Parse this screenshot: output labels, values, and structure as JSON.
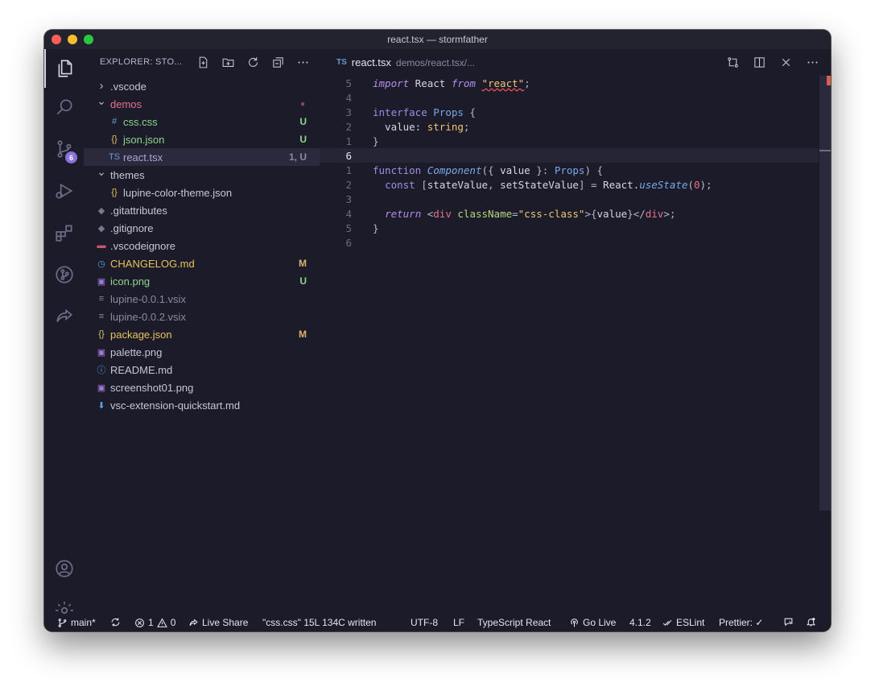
{
  "window": {
    "title": "react.tsx — stormfather"
  },
  "activity": {
    "scm_badge": "6"
  },
  "sidebar": {
    "title": "EXPLORER: STO...",
    "items": [
      {
        "label": ".vscode",
        "type": "folder",
        "expanded": false,
        "indent": 0,
        "color": "#c8c6d6",
        "icon": "chevron-right-icon",
        "status": ""
      },
      {
        "label": "demos",
        "type": "folder",
        "expanded": true,
        "indent": 0,
        "color": "#e8708a",
        "icon": "chevron-down-icon",
        "status": "●",
        "status_color": "#8b4a56"
      },
      {
        "label": "css.css",
        "type": "file",
        "indent": 1,
        "color": "#8fd48a",
        "icon": "hash-icon",
        "icon_glyph": "#",
        "icon_color": "#5aa3d9",
        "status": "U",
        "status_color": "#8fd48a"
      },
      {
        "label": "json.json",
        "type": "file",
        "indent": 1,
        "color": "#8fd48a",
        "icon": "braces-icon",
        "icon_glyph": "{}",
        "icon_color": "#e8c35a",
        "status": "U",
        "status_color": "#8fd48a"
      },
      {
        "label": "react.tsx",
        "type": "file",
        "indent": 1,
        "color": "#a9a4d6",
        "icon": "typescript-icon",
        "icon_glyph": "TS",
        "icon_color": "#6f97d0",
        "status": "1, U",
        "status_color": "#8d8aa0",
        "selected": true
      },
      {
        "label": "themes",
        "type": "folder",
        "expanded": true,
        "indent": 0,
        "color": "#c8c6d6",
        "icon": "chevron-down-icon",
        "status": ""
      },
      {
        "label": "lupine-color-theme.json",
        "type": "file",
        "indent": 1,
        "color": "#c8c6d6",
        "icon": "braces-icon",
        "icon_glyph": "{}",
        "icon_color": "#e8c35a",
        "status": ""
      },
      {
        "label": ".gitattributes",
        "type": "file",
        "indent": 0,
        "color": "#c8c6d6",
        "icon": "git-diamond-icon",
        "icon_glyph": "◆",
        "icon_color": "#7a7890",
        "status": ""
      },
      {
        "label": ".gitignore",
        "type": "file",
        "indent": 0,
        "color": "#c8c6d6",
        "icon": "git-diamond-icon",
        "icon_glyph": "◆",
        "icon_color": "#7a7890",
        "status": ""
      },
      {
        "label": ".vscodeignore",
        "type": "file",
        "indent": 0,
        "color": "#c8c6d6",
        "icon": "ignore-icon",
        "icon_glyph": "▬",
        "icon_color": "#c75a6a",
        "status": ""
      },
      {
        "label": "CHANGELOG.md",
        "type": "file",
        "indent": 0,
        "color": "#e8c35a",
        "icon": "clock-icon",
        "icon_glyph": "◷",
        "icon_color": "#5aa3d9",
        "status": "M",
        "status_color": "#d9b46a"
      },
      {
        "label": "icon.png",
        "type": "file",
        "indent": 0,
        "color": "#8fd48a",
        "icon": "image-icon",
        "icon_glyph": "▣",
        "icon_color": "#a07ad8",
        "status": "U",
        "status_color": "#8fd48a"
      },
      {
        "label": "lupine-0.0.1.vsix",
        "type": "file",
        "indent": 0,
        "color": "#8d8aa0",
        "icon": "lines-icon",
        "icon_glyph": "≡",
        "icon_color": "#8d8aa0",
        "status": ""
      },
      {
        "label": "lupine-0.0.2.vsix",
        "type": "file",
        "indent": 0,
        "color": "#8d8aa0",
        "icon": "lines-icon",
        "icon_glyph": "≡",
        "icon_color": "#8d8aa0",
        "status": ""
      },
      {
        "label": "package.json",
        "type": "file",
        "indent": 0,
        "color": "#e8c35a",
        "icon": "braces-icon",
        "icon_glyph": "{}",
        "icon_color": "#e8c35a",
        "status": "M",
        "status_color": "#d9b46a"
      },
      {
        "label": "palette.png",
        "type": "file",
        "indent": 0,
        "color": "#c8c6d6",
        "icon": "image-icon",
        "icon_glyph": "▣",
        "icon_color": "#a07ad8",
        "status": ""
      },
      {
        "label": "README.md",
        "type": "file",
        "indent": 0,
        "color": "#c8c6d6",
        "icon": "info-icon",
        "icon_glyph": "ⓘ",
        "icon_color": "#5aa3d9",
        "status": ""
      },
      {
        "label": "screenshot01.png",
        "type": "file",
        "indent": 0,
        "color": "#c8c6d6",
        "icon": "image-icon",
        "icon_glyph": "▣",
        "icon_color": "#a07ad8",
        "status": ""
      },
      {
        "label": "vsc-extension-quickstart.md",
        "type": "file",
        "indent": 0,
        "color": "#c8c6d6",
        "icon": "download-icon",
        "icon_glyph": "⬇",
        "icon_color": "#5aa3d9",
        "status": ""
      }
    ]
  },
  "tab": {
    "prefix": "TS",
    "name": "react.tsx",
    "path": "demos/react.tsx/..."
  },
  "code": {
    "lines": [
      {
        "n": "5",
        "tokens": [
          [
            "kwi",
            "import"
          ],
          [
            "",
            " React "
          ],
          [
            "kwi",
            "from"
          ],
          [
            "",
            " "
          ],
          [
            "str squig",
            "\"react\""
          ],
          [
            "punc",
            ";"
          ]
        ]
      },
      {
        "n": "4",
        "tokens": []
      },
      {
        "n": "3",
        "tokens": [
          [
            "kw",
            "interface"
          ],
          [
            "",
            " "
          ],
          [
            "ty",
            "Props"
          ],
          [
            "punc",
            " {"
          ]
        ]
      },
      {
        "n": "2",
        "tokens": [
          [
            "",
            "  value: "
          ],
          [
            "str",
            "string"
          ],
          [
            "punc",
            ";"
          ]
        ]
      },
      {
        "n": "1",
        "tokens": [
          [
            "punc",
            "}"
          ]
        ]
      },
      {
        "n": "6",
        "tokens": [],
        "current": true
      },
      {
        "n": "1",
        "tokens": [
          [
            "kw",
            "function"
          ],
          [
            "",
            " "
          ],
          [
            "fn",
            "Component"
          ],
          [
            "punc",
            "({ "
          ],
          [
            "",
            "value"
          ],
          [
            "punc",
            " }: "
          ],
          [
            "ty",
            "Props"
          ],
          [
            "punc",
            ") {"
          ]
        ]
      },
      {
        "n": "2",
        "tokens": [
          [
            "",
            "  "
          ],
          [
            "kw",
            "const"
          ],
          [
            "punc",
            " ["
          ],
          [
            "",
            "stateValue"
          ],
          [
            "punc",
            ", "
          ],
          [
            "",
            "setStateValue"
          ],
          [
            "punc",
            "] = "
          ],
          [
            "",
            "React."
          ],
          [
            "fn",
            "useState"
          ],
          [
            "punc",
            "("
          ],
          [
            "num",
            "0"
          ],
          [
            "punc",
            ");"
          ]
        ]
      },
      {
        "n": "3",
        "tokens": []
      },
      {
        "n": "4",
        "tokens": [
          [
            "",
            "  "
          ],
          [
            "kwi",
            "return"
          ],
          [
            "punc",
            " <"
          ],
          [
            "tag",
            "div"
          ],
          [
            "",
            " "
          ],
          [
            "attr",
            "className"
          ],
          [
            "punc",
            "="
          ],
          [
            "str",
            "\"css-class\""
          ],
          [
            "punc",
            ">{"
          ],
          [
            "",
            "value"
          ],
          [
            "punc",
            "}</"
          ],
          [
            "tag",
            "div"
          ],
          [
            "punc",
            ">;"
          ]
        ]
      },
      {
        "n": "5",
        "tokens": [
          [
            "punc",
            "}"
          ]
        ]
      },
      {
        "n": "6",
        "tokens": []
      }
    ]
  },
  "status": {
    "branch": "main*",
    "errors": "1",
    "warnings": "0",
    "live_share": "Live Share",
    "message": "\"css.css\" 15L 134C written",
    "encoding": "UTF-8",
    "eol": "LF",
    "language": "TypeScript React",
    "go_live": "Go Live",
    "version": "4.1.2",
    "eslint": "ESLint",
    "prettier": "Prettier: ✓"
  }
}
